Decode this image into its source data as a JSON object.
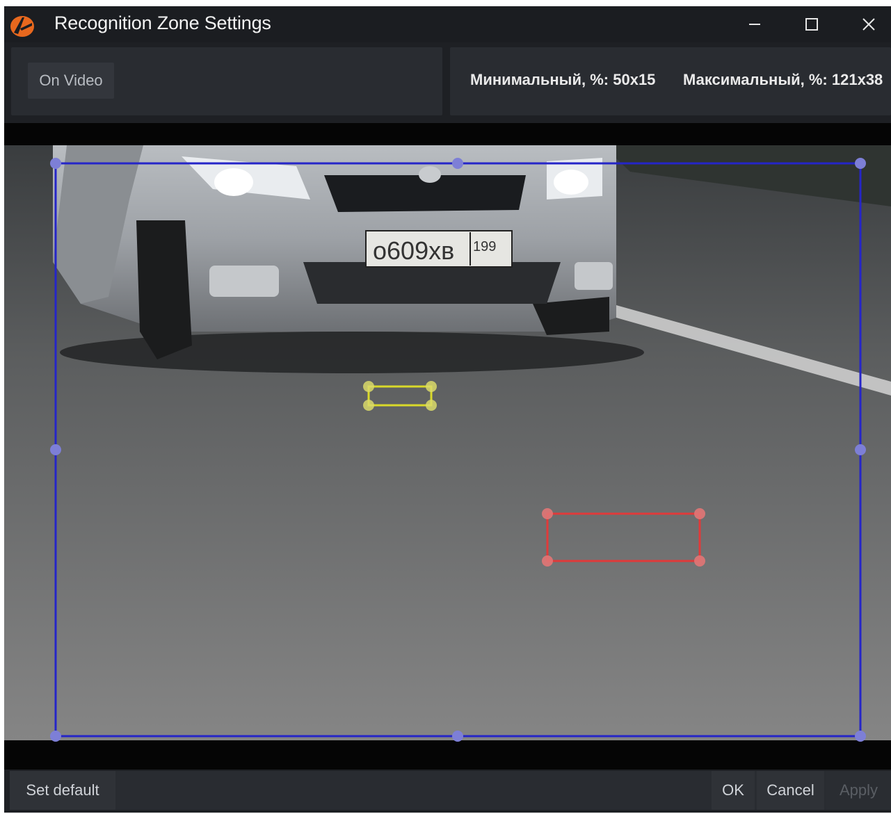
{
  "window": {
    "title": "Recognition Zone Settings"
  },
  "toolbar": {
    "on_video_label": "On Video",
    "min_size_label": "Минимальный, %:",
    "min_size_value": "50x15",
    "max_size_label": "Максимальный, %:",
    "max_size_value": "121x38"
  },
  "video": {
    "plate_text": "о609хв",
    "plate_region": "199",
    "zone_color": "#2525c8",
    "min_box_color": "#d9d92a",
    "max_box_color": "#e03a3a"
  },
  "footer": {
    "set_default_label": "Set default",
    "ok_label": "OK",
    "cancel_label": "Cancel",
    "apply_label": "Apply"
  },
  "colors": {
    "window_bg": "#1e2024",
    "panel_bg": "#292c31",
    "accent_orange": "#e8681e"
  }
}
